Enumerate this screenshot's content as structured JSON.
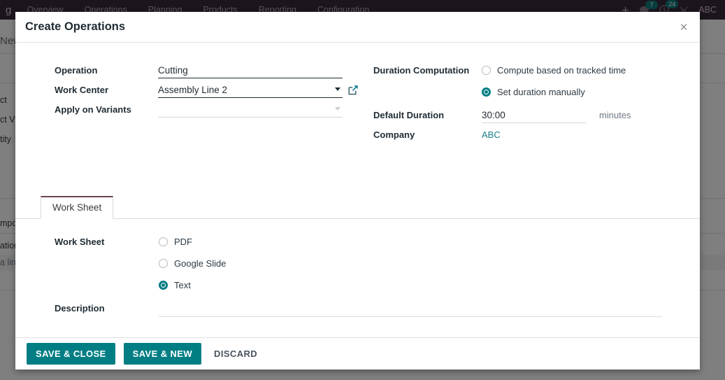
{
  "navbar": {
    "brand": "g",
    "menu": [
      {
        "label": "Overview"
      },
      {
        "label": "Operations"
      },
      {
        "label": "Planning"
      },
      {
        "label": "Products"
      },
      {
        "label": "Reporting"
      },
      {
        "label": "Configuration"
      }
    ],
    "icons": {
      "plus": "plus-icon",
      "messages": "message-icon",
      "activities": "clock-icon",
      "debug": "bug-icon"
    },
    "badges": {
      "messages": "7",
      "activities": "24"
    },
    "user": "ABC"
  },
  "background": {
    "breadcrumb": "New",
    "labels": [
      "ct",
      "ct V",
      "tity",
      "mpo",
      "ation",
      "a lin"
    ]
  },
  "dialog": {
    "title": "Create Operations",
    "close_icon": "close-icon",
    "form": {
      "operation": {
        "label": "Operation",
        "value": "Cutting",
        "placeholder": ""
      },
      "work_center": {
        "label": "Work Center",
        "value": "Assembly Line 2",
        "placeholder": "",
        "dropdown_icon": "chevron-down-icon",
        "external_link_icon": "external-link-icon"
      },
      "apply_on_variants": {
        "label": "Apply on Variants",
        "value": "",
        "placeholder": "",
        "dropdown_icon": "chevron-down-icon"
      },
      "duration_computation": {
        "label": "Duration Computation",
        "options": [
          {
            "label": "Compute based on tracked time",
            "selected": false
          },
          {
            "label": "Set duration manually",
            "selected": true
          }
        ]
      },
      "default_duration": {
        "label": "Default Duration",
        "value": "30:00",
        "suffix": "minutes"
      },
      "company": {
        "label": "Company",
        "value": "ABC"
      }
    },
    "notebook": {
      "tabs": [
        {
          "label": "Work Sheet",
          "active": true
        }
      ],
      "work_sheet": {
        "label": "Work Sheet",
        "options": [
          {
            "label": "PDF",
            "selected": false
          },
          {
            "label": "Google Slide",
            "selected": false
          },
          {
            "label": "Text",
            "selected": true
          }
        ]
      },
      "description": {
        "label": "Description",
        "value": "",
        "placeholder": ""
      }
    },
    "footer": {
      "save_close_label": "SAVE & CLOSE",
      "save_new_label": "SAVE & NEW",
      "discard_label": "DISCARD"
    }
  },
  "colors": {
    "accent_teal": "#017e84",
    "navbar": "#3b2b3c",
    "tab_active_border": "#6b4550",
    "link": "#1a7b8b"
  }
}
